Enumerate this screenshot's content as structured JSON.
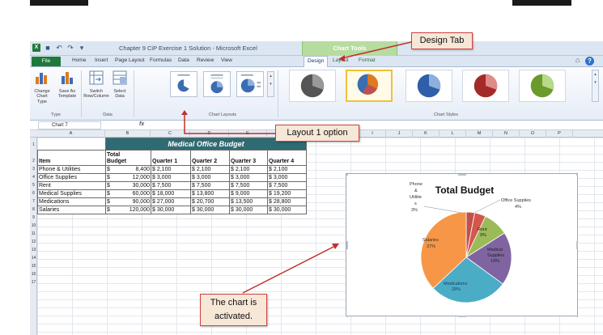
{
  "window": {
    "title": "Chapter 9 CiP Exercise 1 Solution - Microsoft Excel",
    "contextual_group": "Chart Tools"
  },
  "tabs": [
    {
      "label": "File"
    },
    {
      "label": "Home"
    },
    {
      "label": "Insert"
    },
    {
      "label": "Page Layout"
    },
    {
      "label": "Formulas"
    },
    {
      "label": "Data"
    },
    {
      "label": "Review"
    },
    {
      "label": "View"
    },
    {
      "label": "Design"
    },
    {
      "label": "Layout"
    },
    {
      "label": "Format"
    }
  ],
  "ribbon": {
    "buttons": {
      "change_chart_type": "Change Chart Type",
      "save_as_template": "Save As Template",
      "switch_row_column": "Switch Row/Column",
      "select_data": "Select Data"
    },
    "groups": {
      "type": "Type",
      "data": "Data",
      "chart_layouts": "Chart Layouts",
      "chart_styles": "Chart Styles"
    }
  },
  "formula_bar": {
    "name_box": "Chart 7",
    "fx": "fx"
  },
  "columns": [
    "A",
    "B",
    "C",
    "D",
    "E",
    "F",
    "G",
    "H",
    "I",
    "J",
    "K",
    "L",
    "M",
    "N",
    "O",
    "P"
  ],
  "rows": [
    "1",
    "2",
    "3",
    "4",
    "5",
    "6",
    "7",
    "8",
    "9",
    "10",
    "11",
    "12",
    "13",
    "14",
    "15",
    "16",
    "17"
  ],
  "sheet": {
    "title": "Medical Office Budget",
    "headers": [
      "Item",
      "Total Budget",
      "Quarter 1",
      "Quarter 2",
      "Quarter 3",
      "Quarter 4"
    ],
    "header_line1": "Total",
    "header_line2": "Budget",
    "rows": [
      [
        "Phone & Utilities",
        "$",
        "8,400",
        "$  2,100",
        "$  2,100",
        "$  2,100",
        "$  2,100"
      ],
      [
        "Office Supplies",
        "$",
        "12,000",
        "$  3,000",
        "$  3,000",
        "$  3,000",
        "$  3,000"
      ],
      [
        "Rent",
        "$",
        "30,000",
        "$  7,500",
        "$  7,500",
        "$  7,500",
        "$  7,500"
      ],
      [
        "Medical Supplies",
        "$",
        "60,000",
        "$ 18,000",
        "$ 13,800",
        "$  9,000",
        "$ 19,200"
      ],
      [
        "Medications",
        "$",
        "90,000",
        "$ 27,000",
        "$ 20,700",
        "$ 13,500",
        "$ 28,800"
      ],
      [
        "Salaries",
        "$",
        "120,000",
        "$ 30,000",
        "$ 30,000",
        "$ 30,000",
        "$ 30,000"
      ]
    ]
  },
  "chart_data": {
    "type": "pie",
    "title": "Total Budget",
    "slices": [
      {
        "label": "Phone & Utilities",
        "percent": 3,
        "color": "#c0504d"
      },
      {
        "label": "Office Supplies",
        "percent": 4,
        "color": "#c0504d"
      },
      {
        "label": "Rent",
        "percent": 9,
        "color": "#9bbb59"
      },
      {
        "label": "Medical Supplies",
        "percent": 19,
        "color": "#8064a2"
      },
      {
        "label": "Medications",
        "percent": 28,
        "color": "#4bacc6"
      },
      {
        "label": "Salaries",
        "percent": 37,
        "color": "#f79646"
      }
    ],
    "labels": {
      "phone_a": "Phone",
      "phone_b": "&",
      "phone_c": "Utilitie",
      "phone_d": "s",
      "phone_e": "3%",
      "office_a": "Office Supplies",
      "office_b": "4%",
      "rent_a": "Rent",
      "rent_b": "9%",
      "medsup_a": "Medical",
      "medsup_b": "Supplies",
      "medsup_c": "19%",
      "meds_a": "Medications",
      "meds_b": "28%",
      "sal_a": "Salaries",
      "sal_b": "37%"
    }
  },
  "callouts": {
    "design_tab": "Design Tab",
    "layout_option": "Layout 1 option",
    "chart_activated_1": "The chart is",
    "chart_activated_2": "activated."
  },
  "colors": {
    "accent": "#d04040",
    "title_fill": "#2f6b73",
    "file_tab": "#1f7a3a",
    "chart_tools": "#b6dca0"
  }
}
